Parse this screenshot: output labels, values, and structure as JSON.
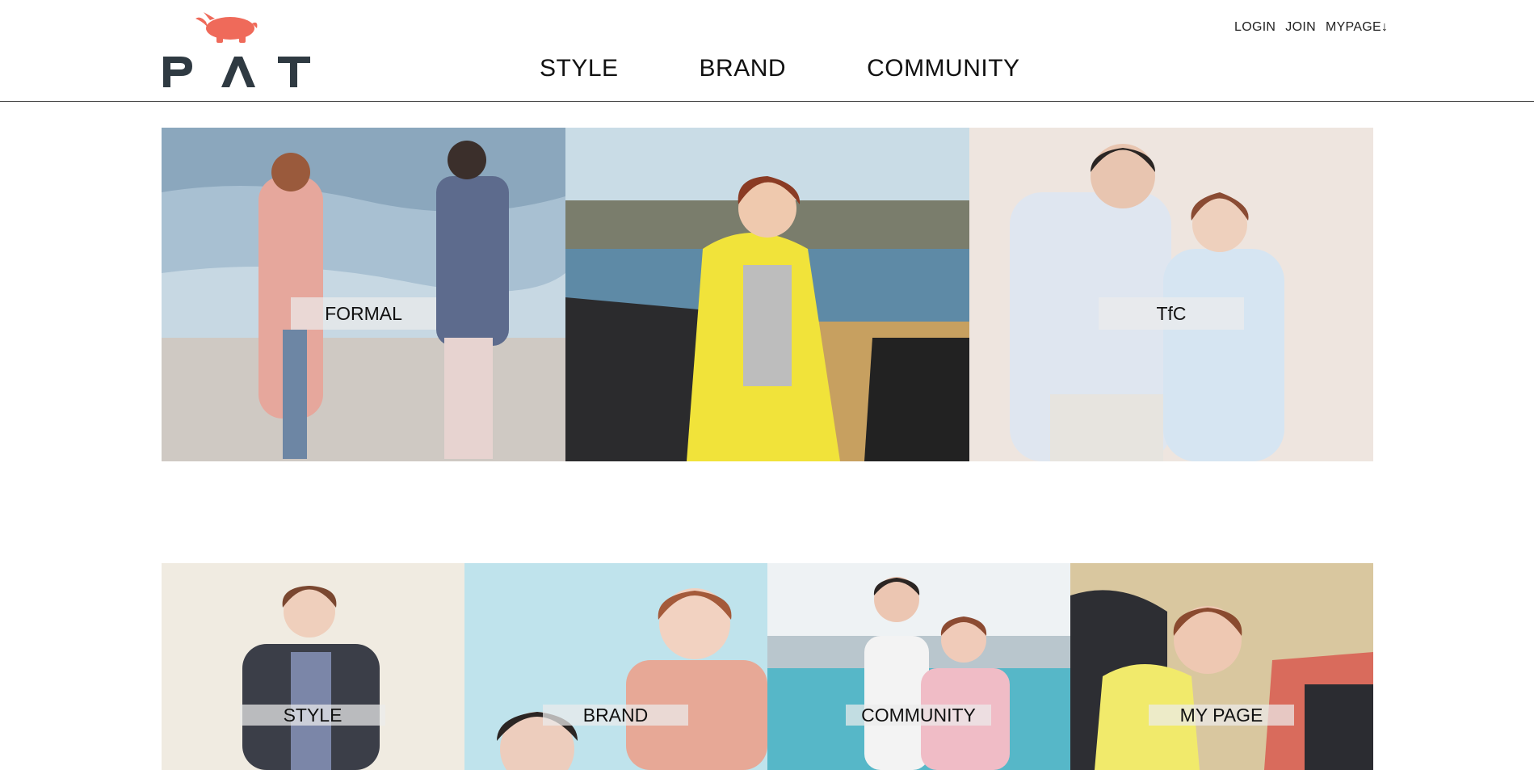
{
  "brand": {
    "logo_text": "PAT",
    "logo_color": "#2f3a42",
    "mascot_color": "#ef6a5a"
  },
  "main_nav": [
    {
      "label": "STYLE"
    },
    {
      "label": "BRAND"
    },
    {
      "label": "COMMUNITY"
    }
  ],
  "util_nav": {
    "login": "LOGIN",
    "join": "JOIN",
    "mypage": "MYPAGE↓"
  },
  "hero": [
    {
      "caption": "FORMAL",
      "icon": "photo-couple-seaside"
    },
    {
      "caption": "",
      "icon": "photo-woman-yellow-jacket-car"
    },
    {
      "caption": "TfC",
      "icon": "photo-couple-white-shirts"
    }
  ],
  "tiles": [
    {
      "caption": "STYLE",
      "icon": "photo-woman-dark-jacket"
    },
    {
      "caption": "BRAND",
      "icon": "photo-couple-pink-jacket"
    },
    {
      "caption": "COMMUNITY",
      "icon": "photo-couple-marina"
    },
    {
      "caption": "MY PAGE",
      "icon": "photo-woman-car"
    }
  ],
  "colors": {
    "header_border": "#444444",
    "background": "#ffffff",
    "caption_bg": "#ebebeb"
  }
}
